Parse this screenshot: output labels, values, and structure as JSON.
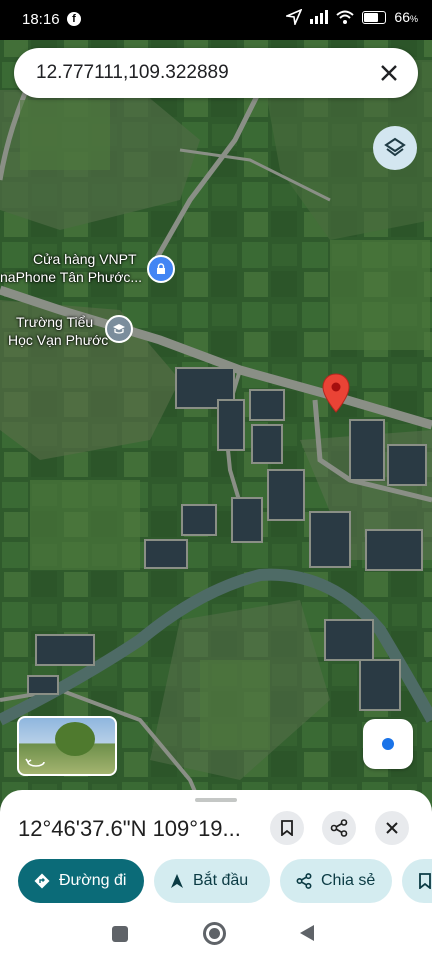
{
  "status_bar": {
    "time": "18:16",
    "battery": "66"
  },
  "search": {
    "query": "12.777111,109.322889"
  },
  "poi": {
    "vnpt_line1": "Cửa hàng VNPT",
    "vnpt_line2": "naPhone Tân Phước...",
    "school_line1": "Trường Tiểu",
    "school_line2": "Học Vạn Phước"
  },
  "place_sheet": {
    "coords_title": "12°46'37.6\"N 109°19..."
  },
  "actions": {
    "directions": "Đường đi",
    "start": "Bắt đầu",
    "share": "Chia sẻ"
  },
  "icons": [
    "facebook-icon",
    "location-arrow-icon",
    "signal-icon",
    "wifi-icon",
    "battery-icon",
    "close-icon",
    "layers-icon",
    "lock-icon",
    "school-icon",
    "map-pin-icon",
    "my-location-icon",
    "bookmark-icon",
    "share-icon",
    "directions-icon",
    "navigation-icon",
    "recents-icon",
    "home-icon",
    "back-icon"
  ],
  "colors": {
    "accent_teal": "#0b6b78",
    "chip_bg": "#d4ecf0",
    "pin_red": "#ea4335",
    "my_location_blue": "#1a73e8"
  }
}
